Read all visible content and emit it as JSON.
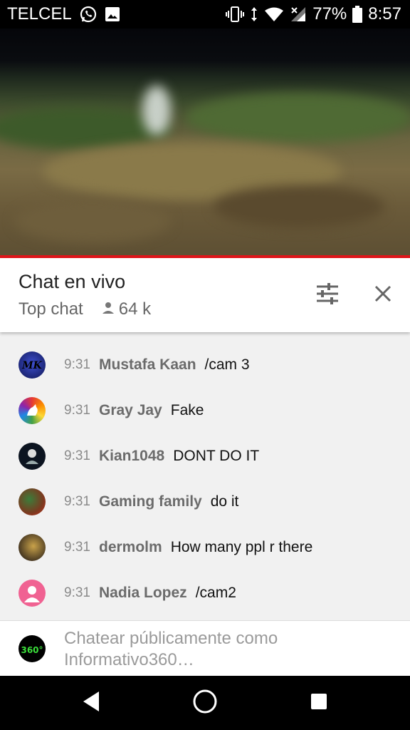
{
  "status_bar": {
    "carrier": "TELCEL",
    "battery": "77%",
    "time": "8:57"
  },
  "chat": {
    "title": "Chat en vivo",
    "mode": "Top chat",
    "viewers": "64 k"
  },
  "messages": [
    {
      "time": "9:31",
      "author": "Mustafa Kaan",
      "text": "/cam 3",
      "avatar_color": "#1d2a8c"
    },
    {
      "time": "9:31",
      "author": "Gray Jay",
      "text": "Fake",
      "avatar_color": "#e94b8c"
    },
    {
      "time": "9:31",
      "author": "Kian1048",
      "text": "DONT DO IT",
      "avatar_color": "#101820"
    },
    {
      "time": "9:31",
      "author": "Gaming family",
      "text": "do it",
      "avatar_color": "#7a4a2a"
    },
    {
      "time": "9:31",
      "author": "dermolm",
      "text": "How many ppl r there",
      "avatar_color": "#5a4a2a"
    },
    {
      "time": "9:31",
      "author": "Nadia Lopez",
      "text": "/cam2",
      "avatar_color": "#f06292"
    }
  ],
  "input": {
    "placeholder_line1": "Chatear públicamente como",
    "placeholder_line2": "Informativo360…",
    "avatar_label": "360°"
  },
  "colors": {
    "progress": "#e0151a",
    "accent_green": "#3adf3a"
  }
}
